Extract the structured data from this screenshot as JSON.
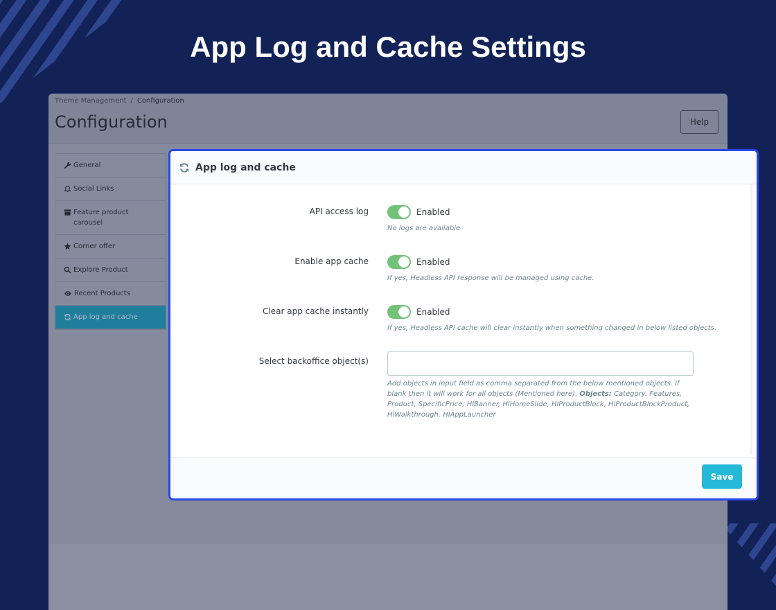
{
  "hero": {
    "title": "App Log and Cache Settings"
  },
  "admin": {
    "breadcrumb": {
      "parent": "Theme Management",
      "separator": "/",
      "current": "Configuration"
    },
    "page_title": "Configuration",
    "help_label": "Help"
  },
  "sidebar": {
    "items": [
      {
        "label": "General",
        "icon": "wrench-icon"
      },
      {
        "label": "Social Links",
        "icon": "bell-icon"
      },
      {
        "label": "Feature product carousel",
        "icon": "archive-icon"
      },
      {
        "label": "Corner offer",
        "icon": "star-icon"
      },
      {
        "label": "Explore Product",
        "icon": "search-icon"
      },
      {
        "label": "Recent Products",
        "icon": "eye-icon"
      },
      {
        "label": "App log and cache",
        "icon": "refresh-icon",
        "active": true
      }
    ]
  },
  "panel": {
    "title": "App log and cache",
    "icon": "refresh-icon",
    "fields": {
      "api_log": {
        "label": "API access log",
        "switch_label": "Enabled",
        "enabled": true,
        "help": "No logs are available"
      },
      "app_cache": {
        "label": "Enable app cache",
        "switch_label": "Enabled",
        "enabled": true,
        "help": "If yes, Headless API response will be managed using cache."
      },
      "clear_cache": {
        "label": "Clear app cache instantly",
        "switch_label": "Enabled",
        "enabled": true,
        "help": "If yes, Headless API cache will clear instantly when something changed in below listed objects."
      },
      "objects": {
        "label": "Select backoffice object(s)",
        "value": "",
        "help_prefix": "Add objects in input field as comma separated from the below mentioned objects. If blank then it will work for all objects (Mentioned here).",
        "help_bold": "Objects:",
        "help_suffix": "Category, Features, Product, SpecificPrice, HlBanner, HlHomeSlide, HlProductBlock, HlProductBlockProduct, HlWalkthrough, HlAppLauncher"
      }
    },
    "save_label": "Save"
  },
  "colors": {
    "background": "#122257",
    "accent": "#25b9d7",
    "switch_on": "#72c279",
    "highlight_border": "#2a48e8"
  }
}
